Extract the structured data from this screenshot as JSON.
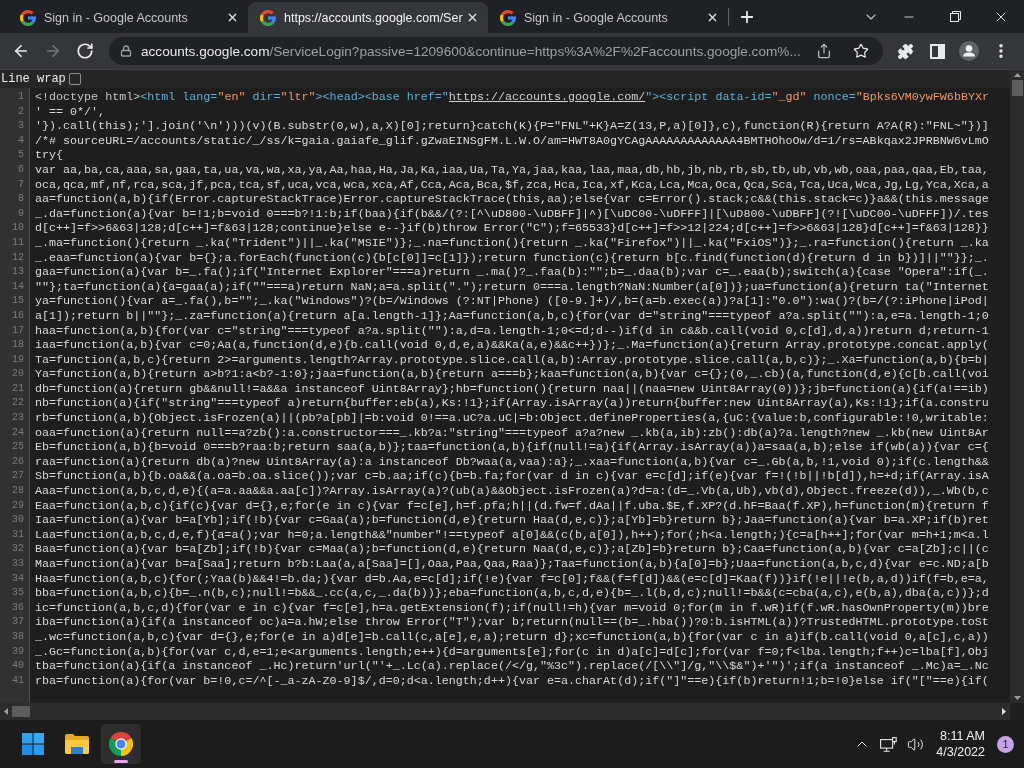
{
  "browser": {
    "tabs": [
      {
        "title": "Sign in - Google Accounts",
        "selected": false
      },
      {
        "title": "https://accounts.google.com/Ser",
        "selected": true
      },
      {
        "title": "Sign in - Google Accounts",
        "selected": false
      }
    ],
    "nav_buttons": [
      {
        "kind": "back",
        "disabled": false
      },
      {
        "kind": "forward",
        "disabled": true
      },
      {
        "kind": "reload",
        "disabled": false
      }
    ],
    "address": {
      "host": "accounts.google.com",
      "path": "/ServiceLogin?passive=1209600&continue=https%3A%2F%2Faccounts.google.com%..."
    }
  },
  "view_source": {
    "line_wrap": {
      "label": "Line wrap",
      "checked": false
    },
    "lines": [
      {
        "number": "1",
        "segments": [
          {
            "kind": "doctype",
            "text": "<!doctype html>"
          },
          {
            "kind": "tag",
            "text": "<html lang="
          },
          {
            "kind": "value",
            "text": "\"en\""
          },
          {
            "kind": "tag",
            "text": " dir="
          },
          {
            "kind": "value",
            "text": "\"ltr\""
          },
          {
            "kind": "tag",
            "text": "><head><base href=\""
          },
          {
            "kind": "link",
            "text": "https://accounts.google.com/"
          },
          {
            "kind": "tag",
            "text": "\"><script data-id="
          },
          {
            "kind": "value",
            "text": "\"_gd\""
          },
          {
            "kind": "tag",
            "text": " nonce="
          },
          {
            "kind": "value",
            "text": "\"Bpks6VM0ywFW6bBYXr"
          }
        ]
      },
      {
        "number": "2",
        "text": "' == 0*/',"
      },
      {
        "number": "3",
        "text": "'}).call(this);'].join('\\n')))(v)(B.substr(0,w),a,X)[0];return}catch(K){P=\"FNL\"+K}A=Z(13,P,a)[0]},c),function(R){return A?A(R):\"FNL~\"})]"
      },
      {
        "number": "4",
        "text": "/*# sourceURL=/accounts/static/_/ss/k=gaia.gaiafe_glif.gZwaEINSgFM.L.W.O/am=HWT8A0gYCAgAAAAAAAAAAAAA4BMTHOhoOw/d=1/rs=ABkqax2JPRBNW6vLmO"
      },
      {
        "number": "5",
        "text": "try{"
      },
      {
        "number": "6",
        "text": "var aa,ba,ca,aaa,sa,gaa,ta,ua,va,wa,xa,ya,Aa,haa,Ha,Ja,Ka,iaa,Ua,Ta,Ya,jaa,kaa,laa,maa,db,hb,jb,nb,rb,sb,tb,ub,vb,wb,oaa,paa,qaa,Eb,taa,"
      },
      {
        "number": "7",
        "text": "oca,qca,mf,nf,rca,sca,jf,pca,tca,sf,uca,vca,wca,xca,Af,Cca,Aca,Bca,$f,zca,Hca,Ica,xf,Kca,Lca,Mca,Oca,Qca,Sca,Tca,Uca,Wca,Jg,Lg,Yca,Xca,a"
      },
      {
        "number": "8",
        "text": "aa=function(a,b){if(Error.captureStackTrace)Error.captureStackTrace(this,aa);else{var c=Error().stack;c&&(this.stack=c)}a&&(this.message"
      },
      {
        "number": "9",
        "text": "_.da=function(a){var b=!1;b=void 0===b?!1:b;if(baa){if(b&&/(?:[^\\uD800-\\uDBFF]|^)[\\uDC00-\\uDFFF]|[\\uD800-\\uDBFF](?![\\uDC00-\\uDFFF])/.tes"
      },
      {
        "number": "10",
        "text": "d[c++]=f>>6&63|128;d[c++]=f&63|128;continue}else e--}if(b)throw Error(\"C\");f=65533}d[c++]=f>>12|224;d[c++]=f>>6&63|128}d[c++]=f&63|128}}"
      },
      {
        "number": "11",
        "text": "_.ma=function(){return _.ka(\"Trident\")||_.ka(\"MSIE\")};_.na=function(){return _.ka(\"Firefox\")||_.ka(\"FxiOS\")};_.ra=function(){return _.ka"
      },
      {
        "number": "12",
        "text": "_.eaa=function(a){var b={};a.forEach(function(c){b[c[0]]=c[1]});return function(c){return b[c.find(function(d){return d in b})]||\"\"}};_."
      },
      {
        "number": "13",
        "text": "gaa=function(a){var b=_.fa();if(\"Internet Explorer\"===a)return _.ma()?_.faa(b):\"\";b=_.daa(b);var c=_.eaa(b);switch(a){case \"Opera\":if(_."
      },
      {
        "number": "14",
        "text": "\"\"};ta=function(a){a=gaa(a);if(\"\"===a)return NaN;a=a.split(\".\");return 0===a.length?NaN:Number(a[0])};ua=function(a){return ta(\"Internet"
      },
      {
        "number": "15",
        "text": "ya=function(){var a=_.fa(),b=\"\";_.ka(\"Windows\")?(b=/Windows (?:NT|Phone) ([0-9.]+)/,b=(a=b.exec(a))?a[1]:\"0.0\"):wa()?(b=/(?:iPhone|iPod|"
      },
      {
        "number": "16",
        "text": "a[1]);return b||\"\"};_.za=function(a){return a[a.length-1]};Aa=function(a,b,c){for(var d=\"string\"===typeof a?a.split(\"\"):a,e=a.length-1;0"
      },
      {
        "number": "17",
        "text": "haa=function(a,b){for(var c=\"string\"===typeof a?a.split(\"\"):a,d=a.length-1;0<=d;d--)if(d in c&&b.call(void 0,c[d],d,a))return d;return-1"
      },
      {
        "number": "18",
        "text": "iaa=function(a,b){var c=0;Aa(a,function(d,e){b.call(void 0,d,e,a)&&Ka(a,e)&&c++})};_.Ma=function(a){return Array.prototype.concat.apply("
      },
      {
        "number": "19",
        "text": "Ta=function(a,b,c){return 2>=arguments.length?Array.prototype.slice.call(a,b):Array.prototype.slice.call(a,b,c)};_.Xa=function(a,b){b=b|"
      },
      {
        "number": "20",
        "text": "Ya=function(a,b){return a>b?1:a<b?-1:0};jaa=function(a,b){return a===b};kaa=function(a,b){var c={};(0,_.cb)(a,function(d,e){c[b.call(voi"
      },
      {
        "number": "21",
        "text": "db=function(a){return gb&&null!=a&&a instanceof Uint8Array};hb=function(){return naa||(naa=new Uint8Array(0))};jb=function(a){if(a!==ib)"
      },
      {
        "number": "22",
        "text": "nb=function(a){if(\"string\"===typeof a)return{buffer:eb(a),Ks:!1};if(Array.isArray(a))return{buffer:new Uint8Array(a),Ks:!1};if(a.constru"
      },
      {
        "number": "23",
        "text": "rb=function(a,b){Object.isFrozen(a)||(pb?a[pb]|=b:void 0!==a.uC?a.uC|=b:Object.defineProperties(a,{uC:{value:b,configurable:!0,writable:"
      },
      {
        "number": "24",
        "text": "oaa=function(a){return null==a?zb():a.constructor===_.kb?a:\"string\"===typeof a?a?new _.kb(a,ib):zb():db(a)?a.length?new _.kb(new Uint8Ar"
      },
      {
        "number": "25",
        "text": "Eb=function(a,b){b=void 0===b?raa:b;return saa(a,b)};taa=function(a,b){if(null!=a){if(Array.isArray(a))a=saa(a,b);else if(wb(a)){var c={"
      },
      {
        "number": "26",
        "text": "raa=function(a){return db(a)?new Uint8Array(a):a instanceof Db?waa(a,vaa):a};_.xaa=function(a,b){var c=_.Gb(a,b,!1,void 0);if(c.length&&"
      },
      {
        "number": "27",
        "text": "Sb=function(a,b){b.oa&&(a.oa=b.oa.slice());var c=b.aa;if(c){b=b.fa;for(var d in c){var e=c[d];if(e){var f=!(!b||!b[d]),h=+d;if(Array.isA"
      },
      {
        "number": "28",
        "text": "Aaa=function(a,b,c,d,e){(a=a.aa&&a.aa[c])?Array.isArray(a)?(ub(a)&&Object.isFrozen(a)?d=a:(d=_.Vb(a,Ub),vb(d),Object.freeze(d)),_.Wb(b,c"
      },
      {
        "number": "29",
        "text": "Eaa=function(a,b,c){if(c){var d={},e;for(e in c){var f=c[e],h=f.pfa;h||(d.fw=f.dAa||f.uba.$E,f.XP?(d.hF=Baa(f.XP),h=function(m){return f"
      },
      {
        "number": "30",
        "text": "Iaa=function(a){var b=a[Yb];if(!b){var c=Gaa(a);b=function(d,e){return Haa(d,e,c)};a[Yb]=b}return b};Jaa=function(a){var b=a.XP;if(b)ret"
      },
      {
        "number": "31",
        "text": "Laa=function(a,b,c,d,e,f){a=a();var h=0;a.length&&\"number\"!==typeof a[0]&&(c(b,a[0]),h++);for(;h<a.length;){c=a[h++];for(var m=h+1;m<a.l"
      },
      {
        "number": "32",
        "text": "Baa=function(a){var b=a[Zb];if(!b){var c=Maa(a);b=function(d,e){return Naa(d,e,c)};a[Zb]=b}return b};Caa=function(a,b){var c=a[Zb];c||(c"
      },
      {
        "number": "33",
        "text": "Maa=function(a){var b=a[Saa];return b?b:Laa(a,a[Saa]=[],Oaa,Paa,Qaa,Raa)};Taa=function(a,b){a[0]=b};Uaa=function(a,b,c,d){var e=c.ND;a[b"
      },
      {
        "number": "34",
        "text": "Haa=function(a,b,c){for(;Yaa(b)&&4!=b.da;){var d=b.Aa,e=c[d];if(!e){var f=c[0];f&&(f=f[d])&&(e=c[d]=Kaa(f))}if(!e||!e(b,a,d))if(f=b,e=a,"
      },
      {
        "number": "35",
        "text": "bba=function(a,b,c){b=_.n(b,c);null!=b&&_.cc(a,c,_.da(b))};eba=function(a,b,c,d,e){b=_.l(b,d,c);null!=b&&(c=cba(a,c),e(b,a),dba(a,c))};d"
      },
      {
        "number": "36",
        "text": "ic=function(a,b,c,d){for(var e in c){var f=c[e],h=a.getExtension(f);if(null!=h){var m=void 0;for(m in f.wR)if(f.wR.hasOwnProperty(m))bre"
      },
      {
        "number": "37",
        "text": "iba=function(a){if(a instanceof oc)a=a.hW;else throw Error(\"T\");var b;return(null==(b=_.hba())?0:b.isHTML(a))?TrustedHTML.prototype.toSt"
      },
      {
        "number": "38",
        "text": "_.wc=function(a,b,c){var d={},e;for(e in a)d[e]=b.call(c,a[e],e,a);return d};xc=function(a,b){for(var c in a)if(b.call(void 0,a[c],c,a))"
      },
      {
        "number": "39",
        "text": "_.Gc=function(a,b){for(var c,d,e=1;e<arguments.length;e++){d=arguments[e];for(c in d)a[c]=d[c];for(var f=0;f<lba.length;f++)c=lba[f],Obj"
      },
      {
        "number": "40",
        "text": "tba=function(a){if(a instanceof _.Hc)return'url(\"'+_.Lc(a).replace(/</g,\"%3c\").replace(/[\\\\\"]/g,\"\\\\$&\")+'\")';if(a instanceof _.Mc)a=_.Nc"
      },
      {
        "number": "41",
        "text": "rba=function(a){for(var b=!0,c=/^[-_a-zA-Z0-9]$/,d=0;d<a.length;d++){var e=a.charAt(d);if(\"]\"==e){if(b)return!1;b=!0}else if(\"[\"==e){if("
      }
    ]
  },
  "taskbar": {
    "apps": [
      {
        "kind": "start",
        "active": false
      },
      {
        "kind": "files",
        "active": false
      },
      {
        "kind": "browser",
        "active": true
      }
    ],
    "time": "8:11 AM",
    "date": "4/3/2022",
    "notifications": "1"
  }
}
